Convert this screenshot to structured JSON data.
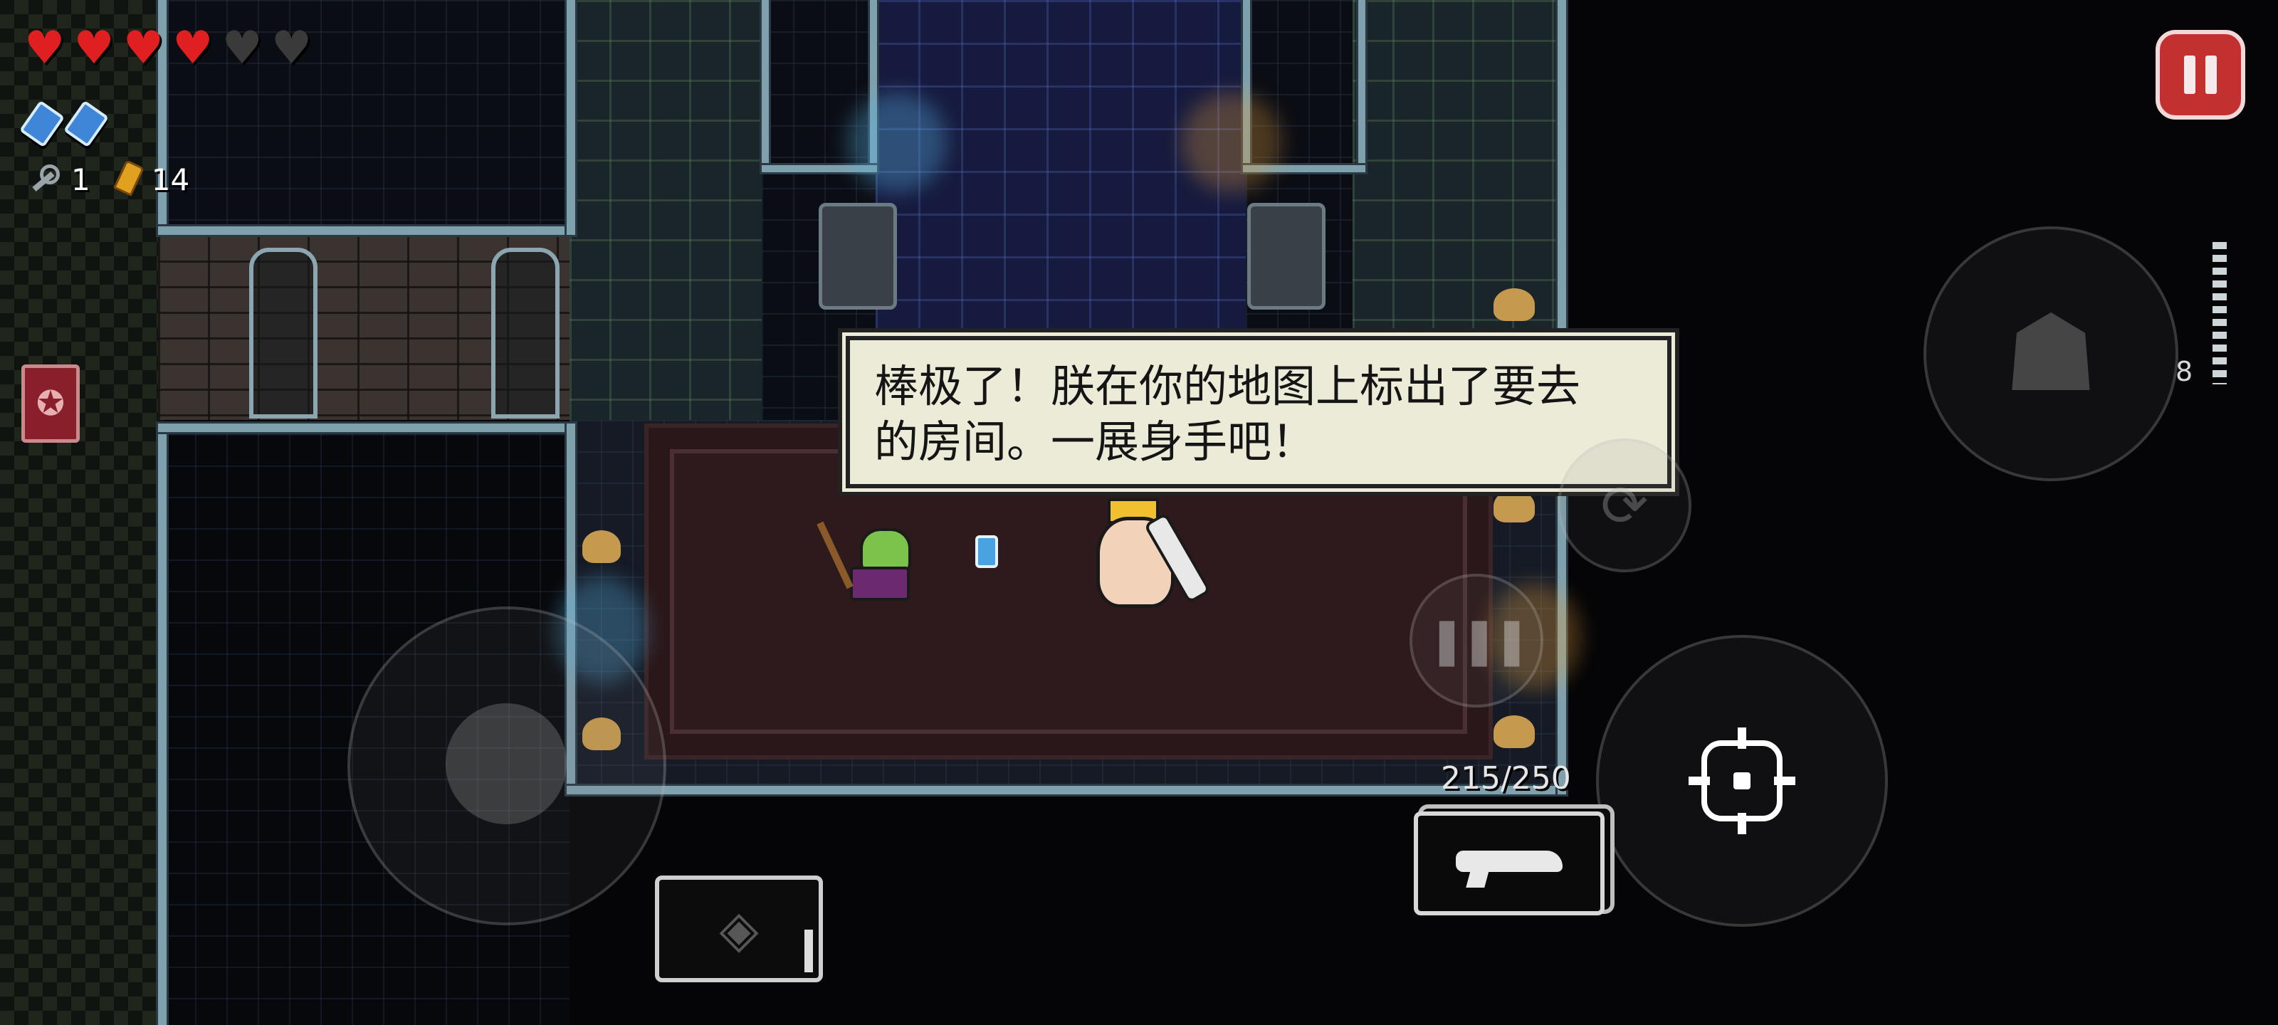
{
  "hud": {
    "hearts": [
      {
        "state": "full"
      },
      {
        "state": "full"
      },
      {
        "state": "full"
      },
      {
        "state": "full"
      },
      {
        "state": "empty"
      },
      {
        "state": "empty"
      }
    ],
    "heart_glyph": "♥",
    "blanks_count": 2,
    "keys": "1",
    "shells": "14",
    "ammo_side_count": "8",
    "gun_ammo": "215/250",
    "colors": {
      "heart_full": "#e02020",
      "heart_empty": "#3a3a3a",
      "blank": "#3f86d8",
      "pause": "#c23030"
    }
  },
  "dialog": {
    "text": "棒极了！朕在你的地图上标出了要去\n的房间。一展身手吧！"
  },
  "controls": {
    "pause_icon": "pause-icon",
    "ghost_glyph": "☗",
    "dodge_glyph": "⟳",
    "interact_glyph": "❚❚❚",
    "active_item_glyph": "◈",
    "book_glyph": "✪"
  }
}
